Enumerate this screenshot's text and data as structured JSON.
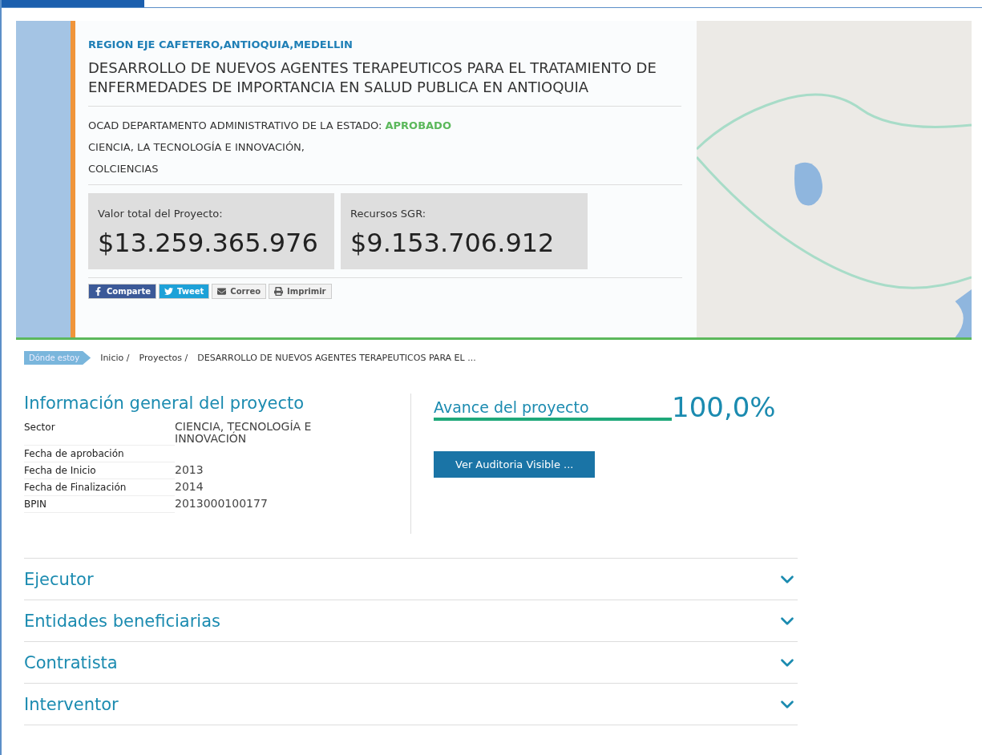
{
  "hero": {
    "region": "REGION EJE CAFETERO,ANTIOQUIA,MEDELLIN",
    "title": "DESARROLLO DE NUEVOS AGENTES TERAPEUTICOS PARA EL TRATAMIENTO DE ENFERMEDADES DE IMPORTANCIA EN SALUD PUBLICA EN ANTIOQUIA",
    "ocad_label": "OCAD DEPARTAMENTO ADMINISTRATIVO DE LA ESTADO:",
    "status": "APROBADO",
    "ocad_lines": [
      "CIENCIA, LA TECNOLOGÍA E INNOVACIÓN,",
      "COLCIENCIAS"
    ],
    "amounts": [
      {
        "label": "Valor total del Proyecto:",
        "value": "$13.259.365.976"
      },
      {
        "label": "Recursos SGR:",
        "value": "$9.153.706.912"
      }
    ],
    "share_buttons": [
      {
        "kind": "facebook",
        "label": "Comparte"
      },
      {
        "kind": "twitter",
        "label": "Tweet"
      },
      {
        "kind": "email",
        "label": "Correo"
      },
      {
        "kind": "print",
        "label": "Imprimir"
      }
    ]
  },
  "breadcrumb": {
    "tag": "Dónde estoy",
    "items": [
      "Inicio /",
      "Proyectos /",
      "DESARROLLO DE NUEVOS AGENTES TERAPEUTICOS PARA EL ..."
    ]
  },
  "general_info": {
    "title": "Información general del proyecto",
    "rows": [
      {
        "label": "Sector",
        "value": "CIENCIA, TECNOLOGÍA E INNOVACIÓN"
      },
      {
        "label": "Fecha de aprobación"
      },
      {
        "label": "Fecha de Inicio",
        "value": "2013"
      },
      {
        "label": "Fecha de Finalización",
        "value": "2014"
      },
      {
        "label": "BPIN",
        "value": "2013000100177"
      }
    ]
  },
  "progress": {
    "title": "Avance del proyecto",
    "level": 1.0,
    "reading": "100,0%",
    "button": "Ver Auditoria Visible ..."
  },
  "sections": [
    {
      "label": "Ejecutor",
      "expanded": false
    },
    {
      "label": "Entidades beneficiarias",
      "expanded": false
    },
    {
      "label": "Contratista",
      "expanded": false
    },
    {
      "label": "Interventor",
      "expanded": false
    }
  ]
}
